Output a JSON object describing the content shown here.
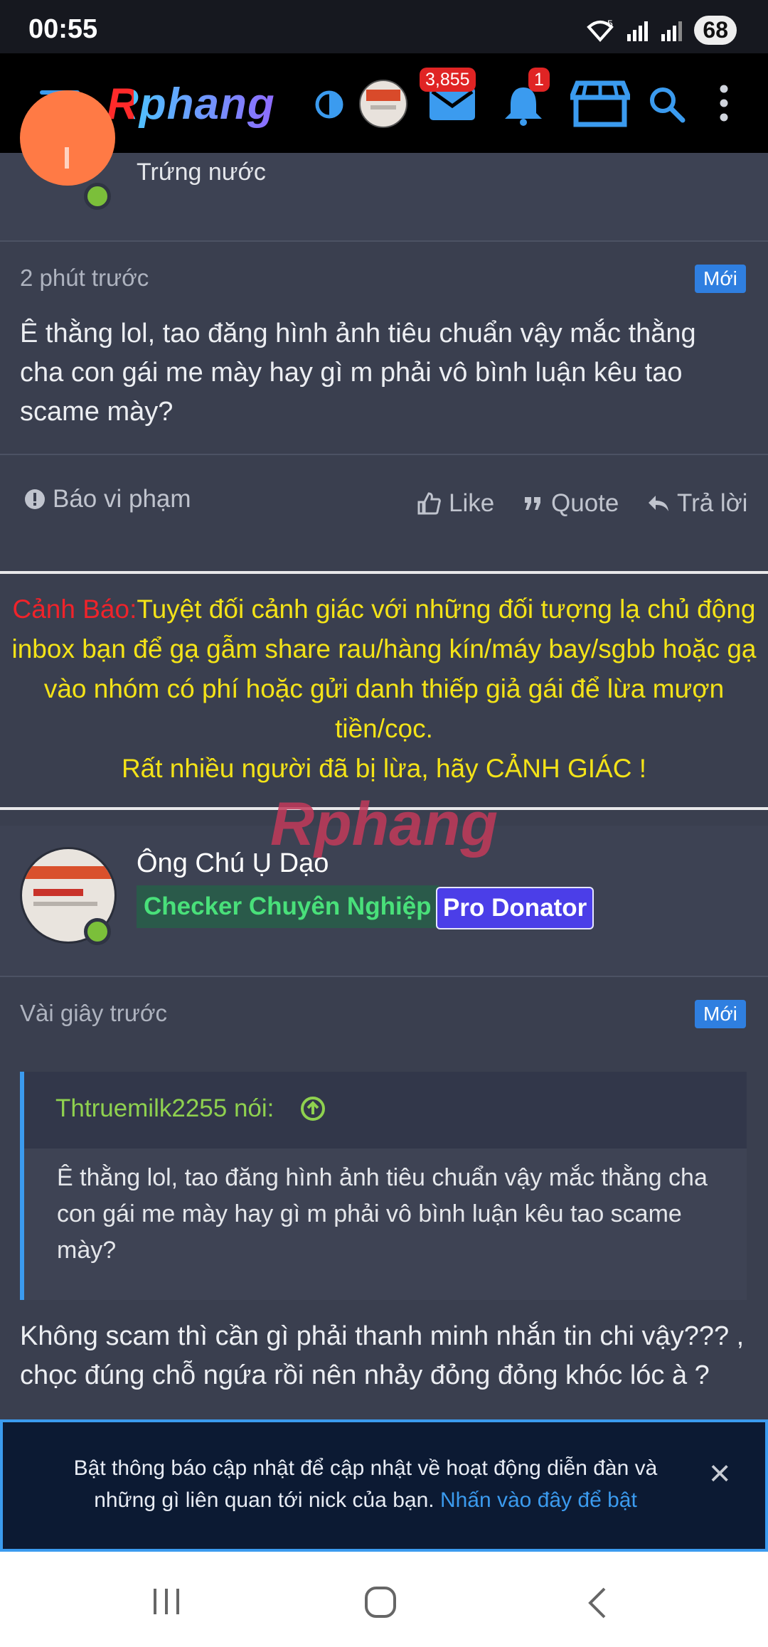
{
  "status": {
    "time": "00:55",
    "battery": "68",
    "wifi_label": "5"
  },
  "nav": {
    "logo": "Rphang",
    "messages_badge": "3,855",
    "alerts_badge": "1",
    "icons": [
      "menu-icon",
      "theme-toggle-icon",
      "avatar",
      "mail-icon",
      "bell-icon",
      "store-icon",
      "search-icon",
      "more-icon"
    ]
  },
  "post1": {
    "user_title": "Trứng nước",
    "time": "2 phút trước",
    "new_label": "Mới",
    "body": "Ê thằng lol, tao đăng hình ảnh tiêu chuẩn vậy mắc thằng cha con gái me mày hay gì m phải vô bình luận kêu tao scame mày?",
    "report": "Báo vi phạm",
    "like": "Like",
    "quote": "Quote",
    "reply": "Trả lời"
  },
  "warning": {
    "label": "Cảnh Báo:",
    "text": "Tuyệt đối cảnh giác với những đối tượng lạ chủ động inbox bạn để gạ gẫm share rau/hàng kín/máy bay/sgbb hoặc gạ vào nhóm có phí hoặc gửi danh thiếp giả gái để lừa mượn tiền/cọc.",
    "text2": "Rất nhiều người đã bị lừa, hãy CẢNH GIÁC !"
  },
  "watermark": "Rphang",
  "post2": {
    "username": "Ông Chú Ụ Dạo",
    "badge1": "Checker Chuyên Nghiệp",
    "badge2": "Pro Donator",
    "time": "Vài giây trước",
    "new_label": "Mới",
    "quote_author": "Thtruemilk2255 nói:",
    "quote_body": "Ê thằng lol, tao đăng hình ảnh tiêu chuẩn vậy mắc thằng cha con gái me mày hay gì m phải vô bình luận kêu tao scame mày?",
    "body": "Không scam thì cần gì phải thanh minh nhắn tin chi vậy??? , chọc đúng chỗ ngứa rồi nên nhảy đỏng đỏng khóc lóc à ?"
  },
  "notification": {
    "text": "Bật thông báo cập nhật để cập nhật về hoạt động diễn đàn và những gì liên quan tới nick của bạn.",
    "link": "Nhấn vào đây để bật",
    "close": "×"
  },
  "colors": {
    "accent": "#3b9bef",
    "danger": "#e02424",
    "warning_text": "#f4e318",
    "warning_label": "#f0232a",
    "checker": "#49e07a",
    "donator": "#4b3ee8"
  }
}
